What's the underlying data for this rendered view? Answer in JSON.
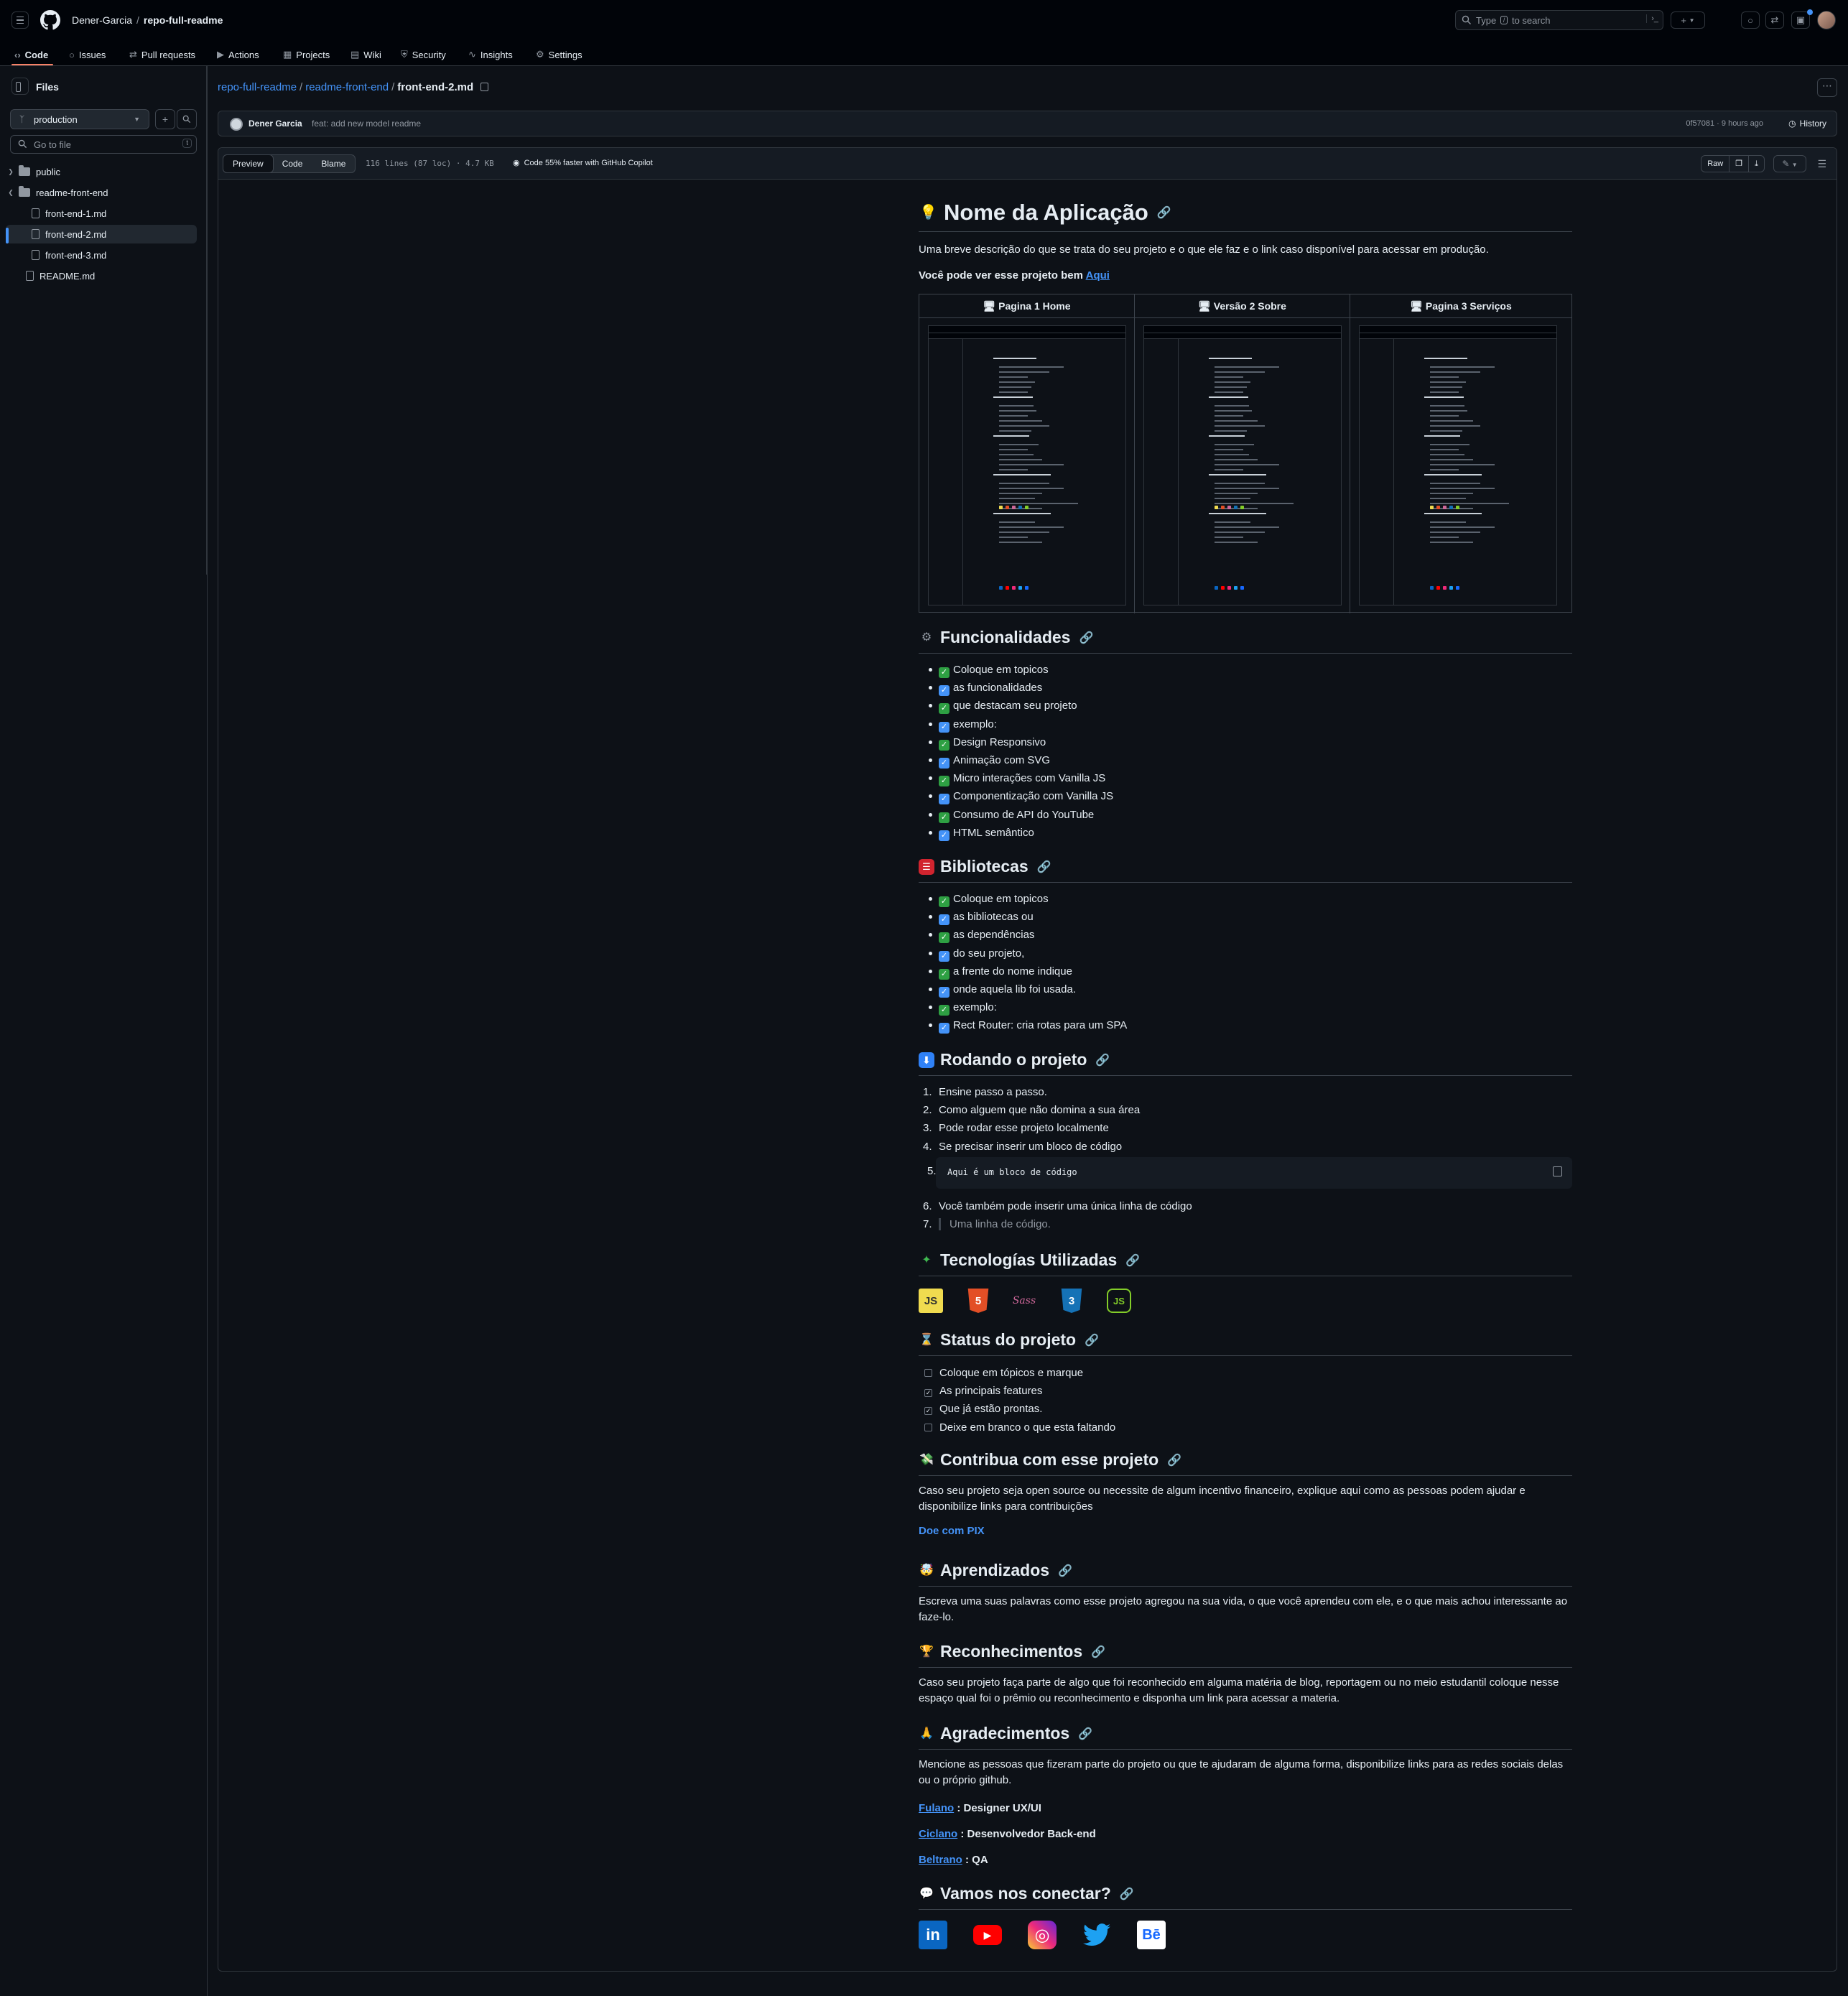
{
  "header": {
    "owner": "Dener-Garcia",
    "separator": "/",
    "repo": "repo-full-readme",
    "search_prefix": "Type",
    "search_slash": "/",
    "search_suffix": "to search",
    "search_cmd": "›_"
  },
  "tabs": [
    {
      "label": "Code",
      "icon": "‹›"
    },
    {
      "label": "Issues",
      "icon": "○"
    },
    {
      "label": "Pull requests",
      "icon": "⇄"
    },
    {
      "label": "Actions",
      "icon": "▶"
    },
    {
      "label": "Projects",
      "icon": "▦"
    },
    {
      "label": "Wiki",
      "icon": "▤"
    },
    {
      "label": "Security",
      "icon": "⛨"
    },
    {
      "label": "Insights",
      "icon": "∿"
    },
    {
      "label": "Settings",
      "icon": "⚙"
    }
  ],
  "sidebar": {
    "title": "Files",
    "branch": "production",
    "goto_placeholder": "Go to file",
    "goto_key": "t",
    "tree": [
      {
        "label": "public",
        "type": "folder",
        "expanded": false
      },
      {
        "label": "readme-front-end",
        "type": "folder",
        "expanded": true
      },
      {
        "label": "front-end-1.md",
        "type": "file"
      },
      {
        "label": "front-end-2.md",
        "type": "file",
        "active": true
      },
      {
        "label": "front-end-3.md",
        "type": "file"
      },
      {
        "label": "README.md",
        "type": "file"
      }
    ]
  },
  "breadcrumb": {
    "repo": "repo-full-readme",
    "dir": "readme-front-end",
    "file": "front-end-2.md",
    "sep": "/"
  },
  "commit": {
    "author": "Dener Garcia",
    "message": "feat: add new model readme",
    "meta": "0f57081 · 9 hours ago",
    "history": "History"
  },
  "file_toolbar": {
    "views": [
      "Preview",
      "Code",
      "Blame"
    ],
    "stats": "116 lines (87 loc) · 4.7 KB",
    "copilot": "Code 55% faster with GitHub Copilot",
    "raw": "Raw"
  },
  "readme": {
    "title": "Nome da Aplicação",
    "description": "Uma breve descrição do que se trata do seu projeto e o que ele faz e o link caso disponível para acessar em produção.",
    "see_prefix": "Você pode ver esse projeto bem",
    "see_link": "Aqui",
    "screens": [
      "Pagina 1 Home",
      "Versão 2 Sobre",
      "Pagina 3 Serviços"
    ],
    "features_title": "Funcionalidades",
    "features": [
      {
        "text": "Coloque em topicos",
        "color": "green"
      },
      {
        "text": "as funcionalidades",
        "color": "blue"
      },
      {
        "text": "que destacam seu projeto",
        "color": "green"
      },
      {
        "text": "exemplo:",
        "color": "blue"
      },
      {
        "text": "Design Responsivo",
        "color": "green"
      },
      {
        "text": "Animação com SVG",
        "color": "blue"
      },
      {
        "text": "Micro interações com Vanilla JS",
        "color": "green"
      },
      {
        "text": "Componentização com Vanilla JS",
        "color": "blue"
      },
      {
        "text": "Consumo de API do YouTube",
        "color": "green"
      },
      {
        "text": "HTML semântico",
        "color": "blue"
      }
    ],
    "libs_title": "Bibliotecas",
    "libs": [
      {
        "text": "Coloque em topicos",
        "color": "green"
      },
      {
        "text": "as bibliotecas ou",
        "color": "blue"
      },
      {
        "text": "as dependências",
        "color": "green"
      },
      {
        "text": "do seu projeto,",
        "color": "blue"
      },
      {
        "text": "a frente do nome indique",
        "color": "green"
      },
      {
        "text": "onde aquela lib foi usada.",
        "color": "blue"
      },
      {
        "text": "exemplo:",
        "color": "green"
      },
      {
        "text": "Rect Router: cria rotas para um SPA",
        "color": "blue"
      }
    ],
    "run_title": "Rodando o projeto",
    "run_steps": [
      "Ensine passo a passo.",
      "Como alguem que não domina a sua área",
      "Pode rodar esse projeto localmente",
      "Se precisar inserir um bloco de código"
    ],
    "code_block": "Aqui é um bloco de código",
    "run_step6": "Você também pode inserir uma única linha de código",
    "code_line": "Uma linha de código.",
    "tech_title": "Tecnologías Utilizadas",
    "tech": [
      "JS",
      "5",
      "Sass",
      "3",
      "JS"
    ],
    "status_title": "Status do projeto",
    "status": [
      {
        "text": "Coloque em tópicos e marque",
        "checked": false
      },
      {
        "text": "As principais features",
        "checked": true
      },
      {
        "text": "Que já estão prontas.",
        "checked": true
      },
      {
        "text": "Deixe em branco o que esta faltando",
        "checked": false
      }
    ],
    "contrib_title": "Contribua com esse projeto",
    "contrib_text": "Caso seu projeto seja open source ou necessite de algum incentivo financeiro, explique aqui como as pessoas podem ajudar e disponibilize links para contribuições",
    "contrib_link": "Doe com PIX",
    "learn_title": "Aprendizados",
    "learn_text": "Escreva uma suas palavras como esse projeto agregou na sua vida, o que você aprendeu com ele, e o que mais achou interessante ao faze-lo.",
    "recog_title": "Reconhecimentos",
    "recog_text": "Caso seu projeto faça parte de algo que foi reconhecido em alguma matéria de blog, reportagem ou no meio estudantil coloque nesse espaço qual foi o prêmio ou reconhecimento e disponha um link para acessar a materia.",
    "thanks_title": "Agradecimentos",
    "thanks_text": "Mencione as pessoas que fizeram parte do projeto ou que te ajudaram de alguma forma, disponibilize links para as redes sociais delas ou o próprio github.",
    "people": [
      {
        "name": "Fulano",
        "role": ": Designer UX/UI"
      },
      {
        "name": "Ciclano",
        "role": ": Desenvolvedor Back-end"
      },
      {
        "name": "Beltrano",
        "role": ": QA"
      }
    ],
    "connect_title": "Vamos nos conectar?",
    "social": [
      "in",
      "▶",
      "◎",
      "♦",
      "Bē"
    ]
  },
  "colors": {
    "accent": "#4493f8",
    "tab_underline": "#f78166",
    "check_green": "#2ea043"
  }
}
